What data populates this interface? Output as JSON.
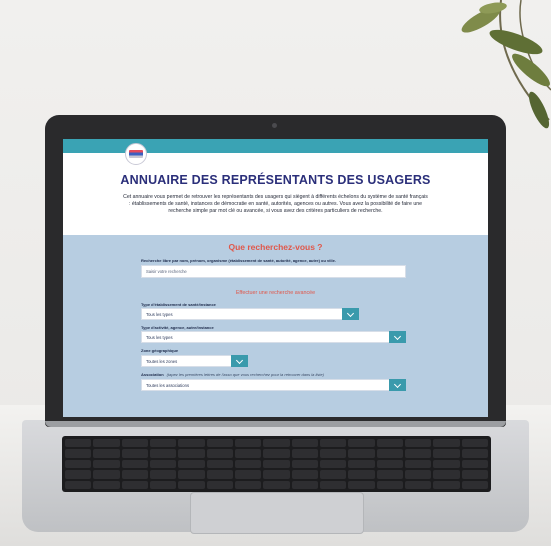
{
  "page": {
    "title": "ANNUAIRE DES REPRÉSENTANTS DES USAGERS",
    "intro": "Cet annuaire vous permet de retrouver les représentants des usagers qui siègent à différents échelons du système de santé français : établissements de santé, instances de démocratie en santé, autorités, agences ou autres. Vous avez la possibilité de faire une recherche simple par mot clé ou avancée, si vous avez des critères particuliers de recherche."
  },
  "search": {
    "heading": "Que recherchez-vous ?",
    "free_label": "Recherche libre par nom, prénom, organisme (établissement de santé, autorité, agence, autre) ou ville.",
    "free_placeholder": "Saisir votre recherche",
    "advanced_label": "Effectuer une recherche avancée",
    "fields": {
      "type_etab": {
        "label": "Type d'établissement de santé/instance",
        "value": "Tous les types"
      },
      "type_activite": {
        "label": "Type d'activité, agence, autre/instance",
        "value": "Tous les types"
      },
      "zone": {
        "label": "Zone géographique",
        "value": "Toutes les zones"
      },
      "association": {
        "label": "Association",
        "hint": "(tapez les premières lettres de l'asso que vous recherchez pour la retrouver dans la liste)",
        "value": "Toutes les associations"
      }
    }
  },
  "colors": {
    "topbar": "#3aa3b4",
    "title": "#2b2f7a",
    "accent": "#e0574a",
    "panel": "#b7cde1",
    "select_button": "#3a9aac"
  },
  "icons": [
    "logo-icon",
    "chevron-down-icon"
  ]
}
